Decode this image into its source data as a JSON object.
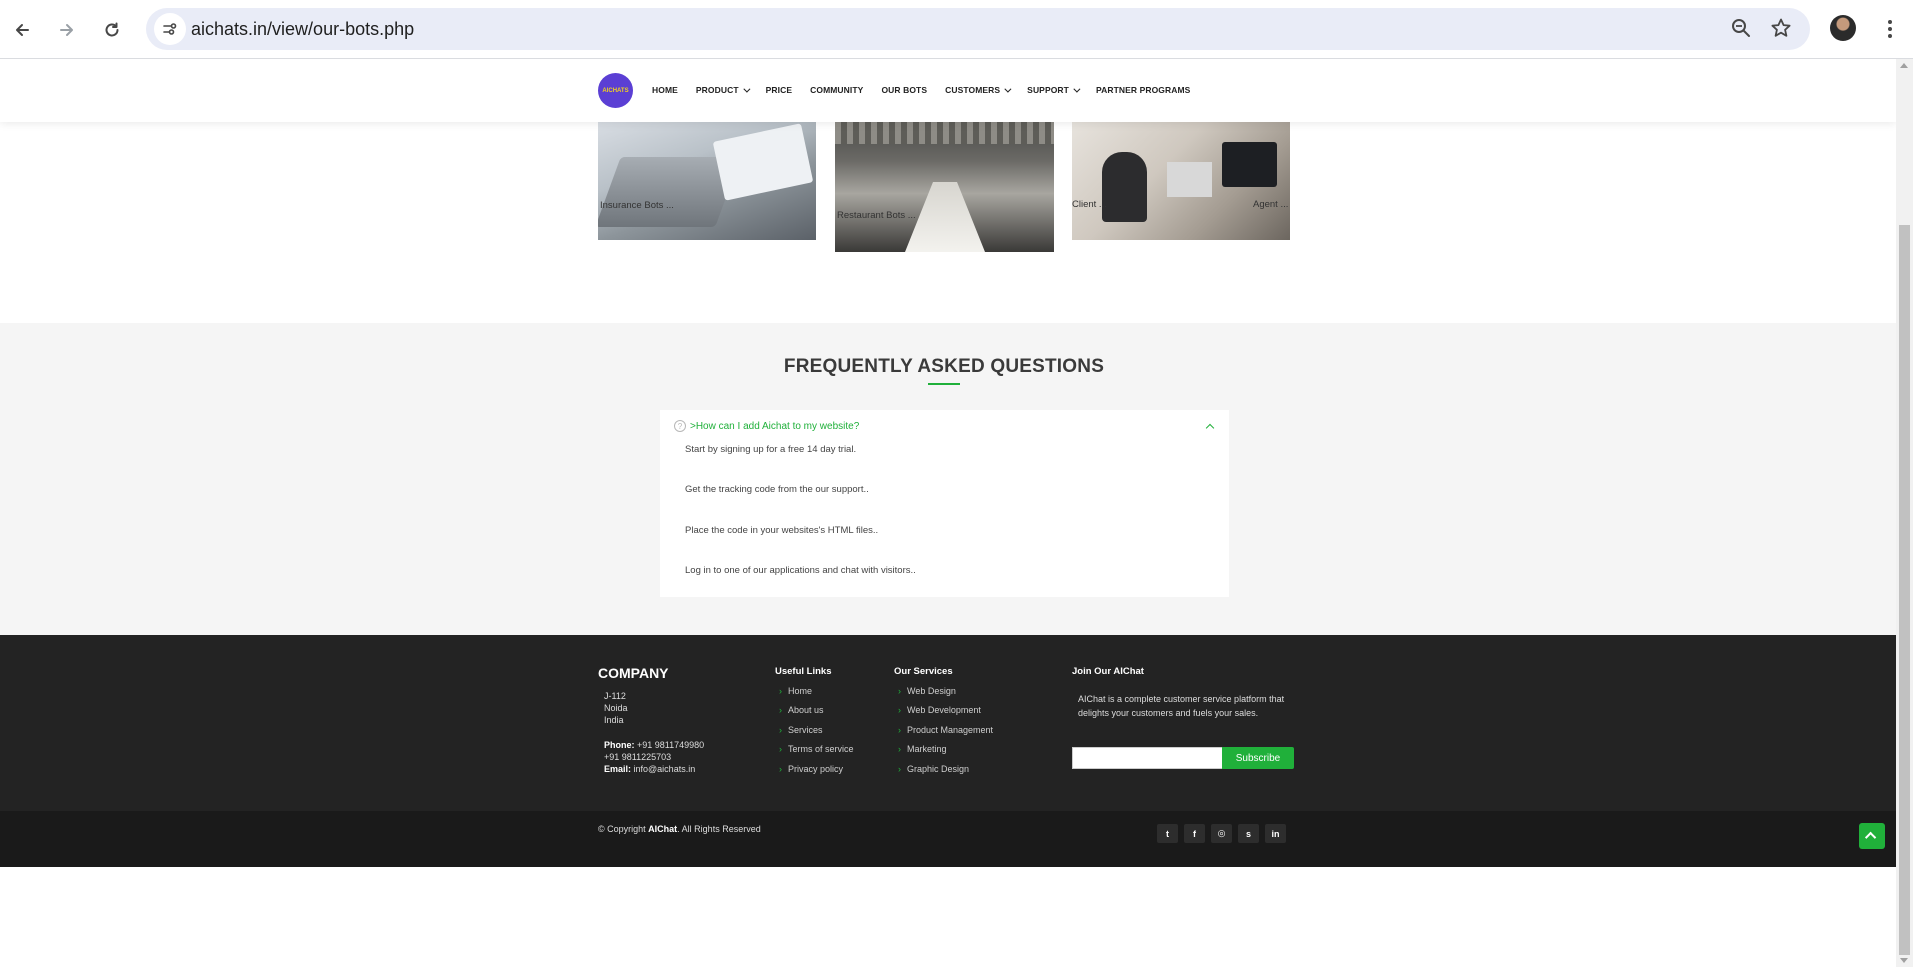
{
  "browser": {
    "url": "aichats.in/view/our-bots.php",
    "icons": [
      "back-arrow-icon",
      "forward-arrow-icon",
      "reload-icon",
      "site-info-icon",
      "zoom-icon",
      "star-icon",
      "avatar",
      "more-menu-icon"
    ]
  },
  "header": {
    "logo_text": "AICHATS",
    "nav": [
      {
        "label": "HOME",
        "has_dropdown": false
      },
      {
        "label": "PRODUCT",
        "has_dropdown": true
      },
      {
        "label": "PRICE",
        "has_dropdown": false
      },
      {
        "label": "COMMUNITY",
        "has_dropdown": false
      },
      {
        "label": "OUR BOTS",
        "has_dropdown": false
      },
      {
        "label": "CUSTOMERS",
        "has_dropdown": true
      },
      {
        "label": "SUPPORT",
        "has_dropdown": true
      },
      {
        "label": "PARTNER PROGRAMS",
        "has_dropdown": false
      }
    ]
  },
  "bots": [
    {
      "label": "Insurance Bots ..."
    },
    {
      "label": "Restaurant Bots ..."
    },
    {
      "label_left": "Client ...",
      "label_right": "Agent ..."
    }
  ],
  "faq": {
    "title": "FREQUENTLY ASKED QUESTIONS",
    "question": ">How can I add Aichat to my website?",
    "answers": [
      "Start by signing up for a free 14 day trial.",
      "Get the tracking code from the our support..",
      "Place the code in your websites's HTML files..",
      "Log in to one of our applications and chat with visitors.."
    ]
  },
  "footer": {
    "company_heading": "COMPANY",
    "address": [
      "J-112",
      "Noida",
      "India"
    ],
    "phone_label": "Phone:",
    "phone_1": "+91 9811749980",
    "phone_2": "+91 9811225703",
    "email_label": "Email:",
    "email": "info@aichats.in",
    "useful_links_heading": "Useful Links",
    "useful_links": [
      "Home",
      "About us",
      "Services",
      "Terms of service",
      "Privacy policy"
    ],
    "services_heading": "Our Services",
    "services": [
      "Web Design",
      "Web Development",
      "Product Management",
      "Marketing",
      "Graphic Design"
    ],
    "join_heading": "Join Our AIChat",
    "join_text": "AIChat is a complete customer service platform that delights your customers and fuels your sales.",
    "subscribe_label": "Subscribe",
    "copyright_prefix": "© Copyright",
    "copyright_brand": "AIChat",
    "copyright_suffix": ". All Rights Reserved",
    "social": [
      {
        "icon": "twitter-icon",
        "glyph": "t"
      },
      {
        "icon": "facebook-icon",
        "glyph": "f"
      },
      {
        "icon": "instagram-icon",
        "glyph": "◎"
      },
      {
        "icon": "skype-icon",
        "glyph": "s"
      },
      {
        "icon": "linkedin-icon",
        "glyph": "in"
      }
    ]
  },
  "colors": {
    "accent": "#20b03a",
    "logo_bg": "#5b3fd4",
    "footer_bg": "#232323"
  }
}
